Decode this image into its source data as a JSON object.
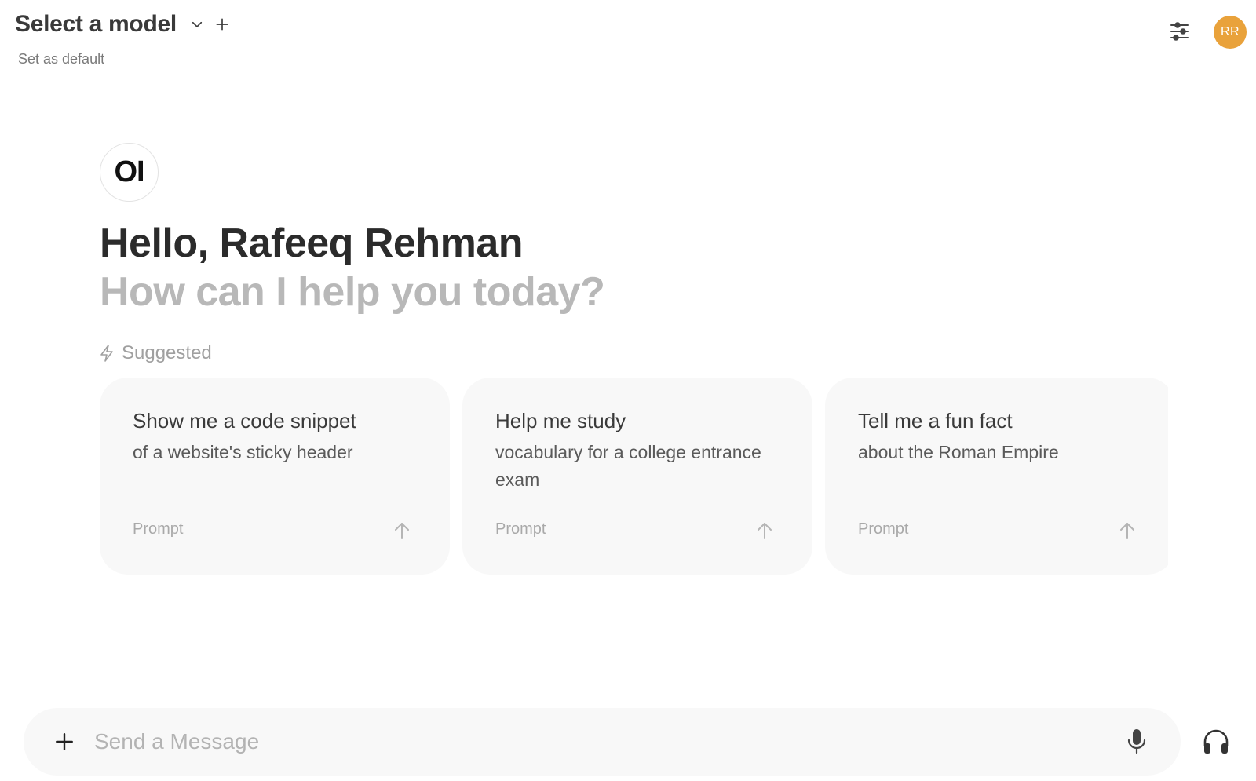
{
  "header": {
    "model_title": "Select a model",
    "set_default": "Set as default",
    "avatar_initials": "RR",
    "avatar_color": "#e9a23b"
  },
  "welcome": {
    "logo_text": "OI",
    "greeting": "Hello, Rafeeq Rehman",
    "subtitle": "How can I help you today?"
  },
  "suggested": {
    "label": "Suggested",
    "icon": "bolt-icon",
    "cards": [
      {
        "title": "Show me a code snippet",
        "subtitle": "of a website's sticky header",
        "footer": "Prompt"
      },
      {
        "title": "Help me study",
        "subtitle": "vocabulary for a college entrance exam",
        "footer": "Prompt"
      },
      {
        "title": "Tell me a fun fact",
        "subtitle": "about the Roman Empire",
        "footer": "Prompt"
      }
    ]
  },
  "composer": {
    "placeholder": "Send a Message",
    "value": ""
  },
  "icons": {
    "model_chevron": "chevron-down-icon",
    "add_model": "plus-icon",
    "controls": "sliders-icon",
    "card_send": "arrow-up-icon",
    "composer_add": "plus-icon",
    "voice": "microphone-icon",
    "call": "headphones-icon"
  }
}
